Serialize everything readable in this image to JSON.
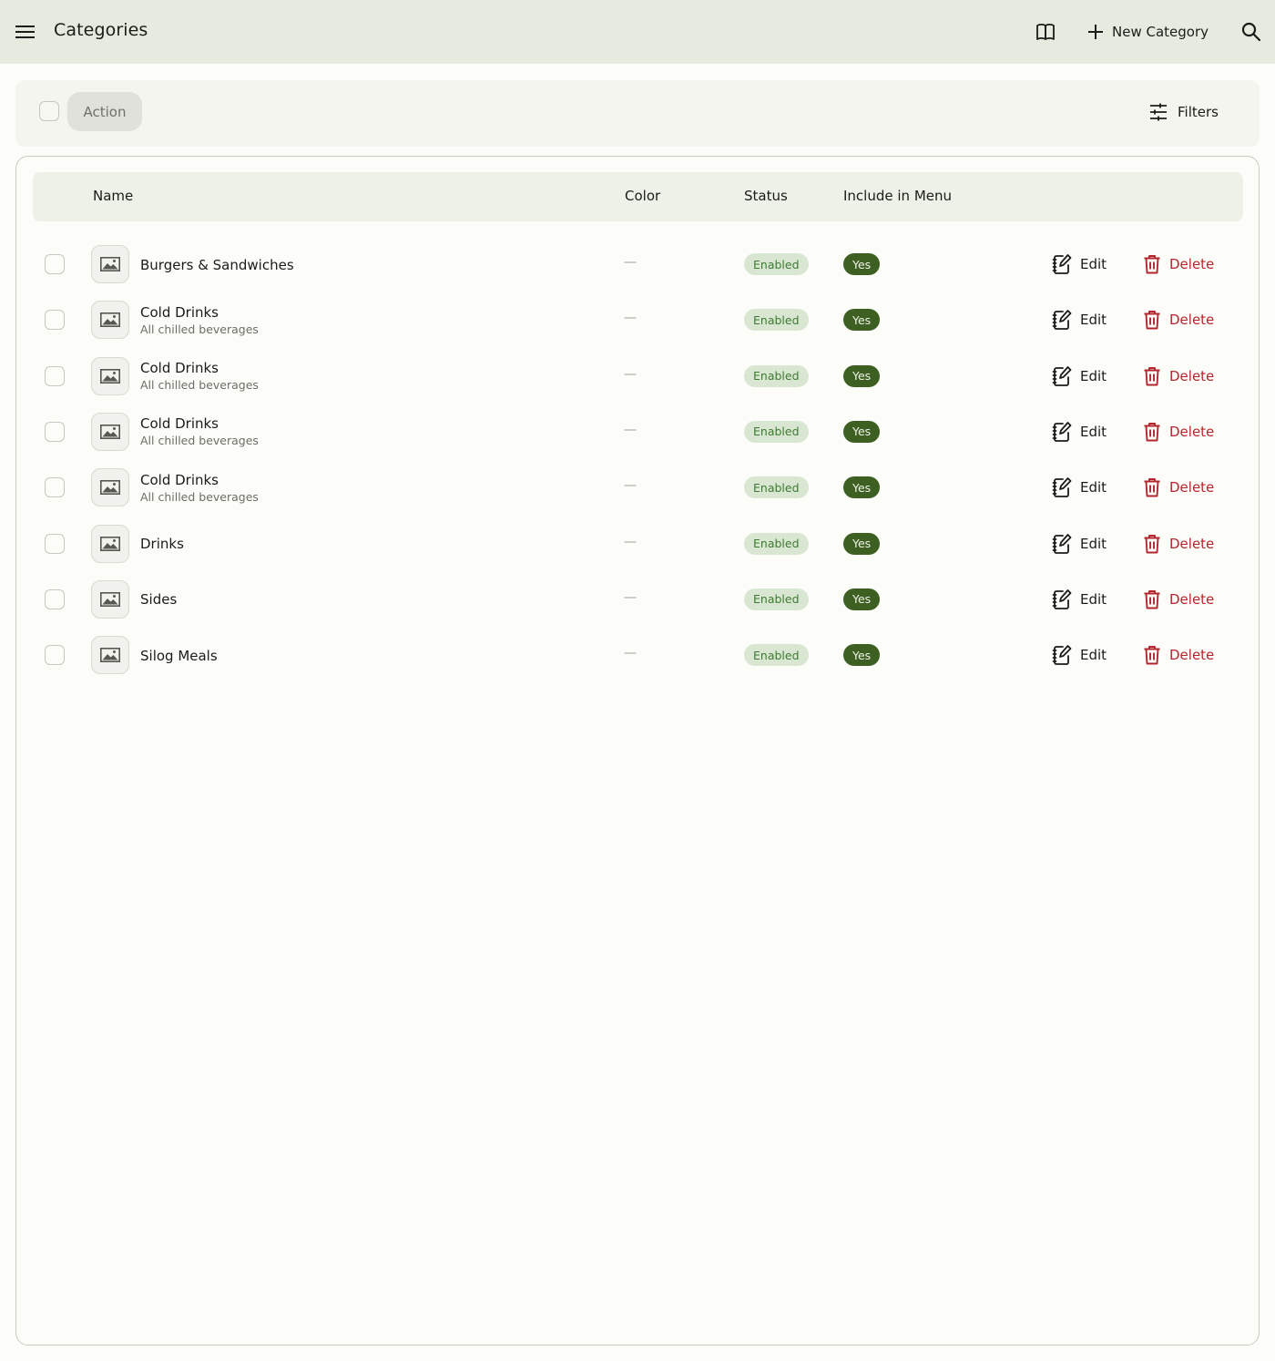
{
  "topbar": {
    "title": "Categories",
    "new_category_label": "New Category",
    "icons": [
      "menu-icon",
      "book-icon",
      "plus-icon",
      "search-icon"
    ]
  },
  "toolbar": {
    "action_label": "Action",
    "filters_label": "Filters"
  },
  "table": {
    "headers": {
      "name": "Name",
      "color": "Color",
      "status": "Status",
      "include_in_menu": "Include in Menu"
    },
    "rows": [
      {
        "name": "Burgers & Sandwiches",
        "subtitle": "",
        "color": "—",
        "status": "Enabled",
        "include_in_menu": "Yes",
        "edit": "Edit",
        "delete": "Delete"
      },
      {
        "name": "Cold Drinks",
        "subtitle": "All chilled beverages",
        "color": "—",
        "status": "Enabled",
        "include_in_menu": "Yes",
        "edit": "Edit",
        "delete": "Delete"
      },
      {
        "name": "Cold Drinks",
        "subtitle": "All chilled beverages",
        "color": "—",
        "status": "Enabled",
        "include_in_menu": "Yes",
        "edit": "Edit",
        "delete": "Delete"
      },
      {
        "name": "Cold Drinks",
        "subtitle": "All chilled beverages",
        "color": "—",
        "status": "Enabled",
        "include_in_menu": "Yes",
        "edit": "Edit",
        "delete": "Delete"
      },
      {
        "name": "Cold Drinks",
        "subtitle": "All chilled beverages",
        "color": "—",
        "status": "Enabled",
        "include_in_menu": "Yes",
        "edit": "Edit",
        "delete": "Delete"
      },
      {
        "name": "Drinks",
        "subtitle": "",
        "color": "—",
        "status": "Enabled",
        "include_in_menu": "Yes",
        "edit": "Edit",
        "delete": "Delete"
      },
      {
        "name": "Sides",
        "subtitle": "",
        "color": "—",
        "status": "Enabled",
        "include_in_menu": "Yes",
        "edit": "Edit",
        "delete": "Delete"
      },
      {
        "name": "Silog Meals",
        "subtitle": "",
        "color": "—",
        "status": "Enabled",
        "include_in_menu": "Yes",
        "edit": "Edit",
        "delete": "Delete"
      }
    ]
  },
  "colors": {
    "topbar_bg": "#e6ebe0",
    "status_badge_bg": "#d9e7d2",
    "status_badge_text": "#3e7a33",
    "menu_badge_bg": "#3e5f22",
    "delete_red": "#b3262e"
  }
}
